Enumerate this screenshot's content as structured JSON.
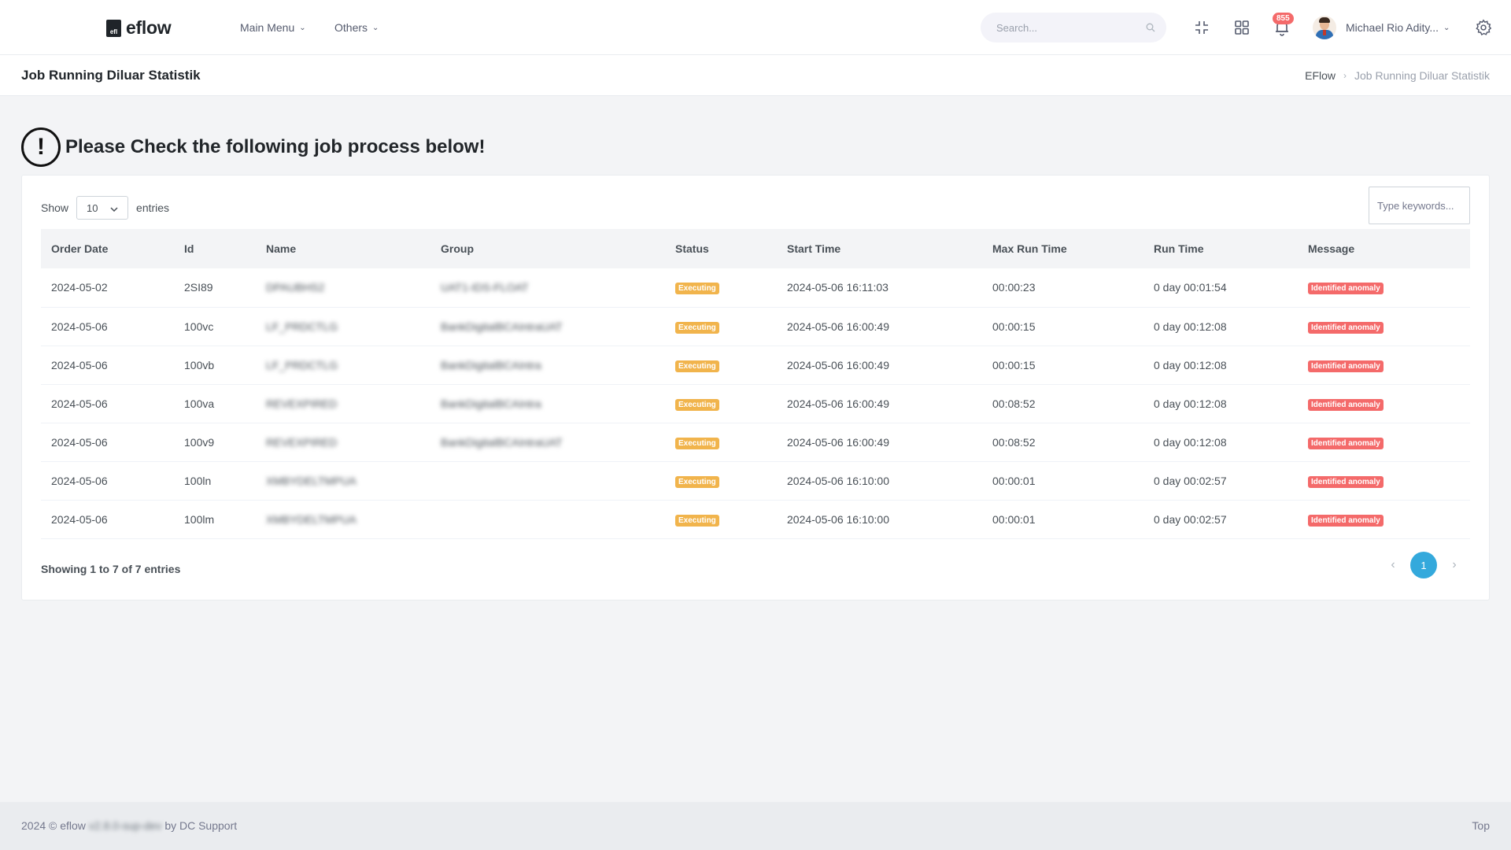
{
  "header": {
    "logo_mark": "efl",
    "logo_text": "eflow",
    "nav": [
      {
        "label": "Main Menu"
      },
      {
        "label": "Others"
      }
    ],
    "search_placeholder": "Search...",
    "notification_count": "855",
    "user_name": "Michael Rio Adity..."
  },
  "titlebar": {
    "title": "Job Running Diluar Statistik",
    "breadcrumb": [
      "EFlow",
      "Job Running Diluar Statistik"
    ]
  },
  "alert": {
    "icon_glyph": "!",
    "text": "Please Check the following job process below!"
  },
  "table_ctrl": {
    "show_label": "Show",
    "entries_value": "10",
    "entries_label": "entries",
    "keyword_placeholder": "Type keywords..."
  },
  "table": {
    "columns": [
      "Order Date",
      "Id",
      "Name",
      "Group",
      "Status",
      "Start Time",
      "Max Run Time",
      "Run Time",
      "Message"
    ],
    "rows": [
      {
        "order_date": "2024-05-02",
        "id": "2SI89",
        "name": "DPAUBHS2",
        "group": "UAT1-IDS-FLOAT",
        "status": "Executing",
        "start_time": "2024-05-06 16:11:03",
        "max_run_time": "00:00:23",
        "run_time": "0 day 00:01:54",
        "message": "Identified anomaly"
      },
      {
        "order_date": "2024-05-06",
        "id": "100vc",
        "name": "LF_PRDCTLG",
        "group": "BankDigitalBCAIntraUAT",
        "status": "Executing",
        "start_time": "2024-05-06 16:00:49",
        "max_run_time": "00:00:15",
        "run_time": "0 day 00:12:08",
        "message": "Identified anomaly"
      },
      {
        "order_date": "2024-05-06",
        "id": "100vb",
        "name": "LF_PRDCTLG",
        "group": "BankDigitalBCAIntra",
        "status": "Executing",
        "start_time": "2024-05-06 16:00:49",
        "max_run_time": "00:00:15",
        "run_time": "0 day 00:12:08",
        "message": "Identified anomaly"
      },
      {
        "order_date": "2024-05-06",
        "id": "100va",
        "name": "REVEXPIRED",
        "group": "BankDigitalBCAIntra",
        "status": "Executing",
        "start_time": "2024-05-06 16:00:49",
        "max_run_time": "00:08:52",
        "run_time": "0 day 00:12:08",
        "message": "Identified anomaly"
      },
      {
        "order_date": "2024-05-06",
        "id": "100v9",
        "name": "REVEXPIRED",
        "group": "BankDigitalBCAIntraUAT",
        "status": "Executing",
        "start_time": "2024-05-06 16:00:49",
        "max_run_time": "00:08:52",
        "run_time": "0 day 00:12:08",
        "message": "Identified anomaly"
      },
      {
        "order_date": "2024-05-06",
        "id": "100ln",
        "name": "XMBYDELTMPUA",
        "group": "",
        "status": "Executing",
        "start_time": "2024-05-06 16:10:00",
        "max_run_time": "00:00:01",
        "run_time": "0 day 00:02:57",
        "message": "Identified anomaly"
      },
      {
        "order_date": "2024-05-06",
        "id": "100lm",
        "name": "XMBYDELTMPUA",
        "group": "",
        "status": "Executing",
        "start_time": "2024-05-06 16:10:00",
        "max_run_time": "00:00:01",
        "run_time": "0 day 00:02:57",
        "message": "Identified anomaly"
      }
    ]
  },
  "table_footer": {
    "info": "Showing 1 to 7 of 7 entries",
    "prev": "‹",
    "current_page": "1",
    "next": "›"
  },
  "footer": {
    "prefix": "2024 © eflow",
    "version": "v2.8.0-sup-dev",
    "suffix": "by DC Support",
    "top_link": "Top"
  },
  "colors": {
    "accent": "#34a9dc",
    "warning": "#f1b44c",
    "danger": "#f46a6a"
  }
}
